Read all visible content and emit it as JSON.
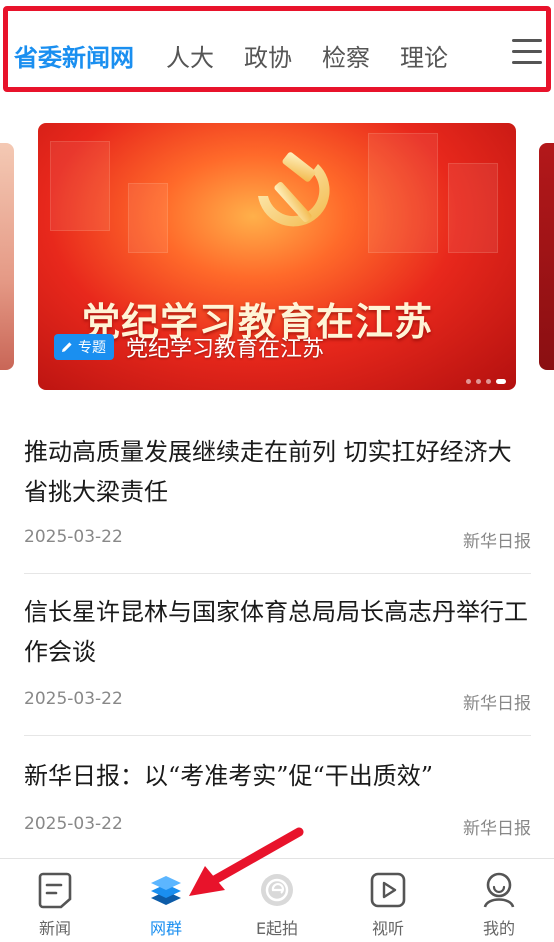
{
  "top_nav": {
    "tabs": [
      {
        "label": "省委新闻网",
        "active": true
      },
      {
        "label": "人大",
        "active": false
      },
      {
        "label": "政协",
        "active": false
      },
      {
        "label": "检察",
        "active": false
      },
      {
        "label": "理论",
        "active": false
      }
    ],
    "menu_icon": "hamburger-menu-icon"
  },
  "banner": {
    "image_text": "党纪学习教育在江苏",
    "badge": "专题",
    "badge_icon": "pencil-icon",
    "caption": "党纪学习教育在江苏",
    "slide_count": 4,
    "active_slide": 4
  },
  "news": [
    {
      "title": "推动高质量发展继续走在前列  切实扛好经济大省挑大梁责任",
      "date": "2025-03-22",
      "source": "新华日报"
    },
    {
      "title": "信长星许昆林与国家体育总局局长高志丹举行工作会谈",
      "date": "2025-03-22",
      "source": "新华日报"
    },
    {
      "title": "新华日报：以“考准考实”促“干出质效”",
      "date": "2025-03-22",
      "source": "新华日报"
    }
  ],
  "bottom_tabs": [
    {
      "label": "新闻",
      "icon": "news-doc-icon",
      "active": false
    },
    {
      "label": "网群",
      "icon": "layers-icon",
      "active": true
    },
    {
      "label": "E起拍",
      "icon": "e-camera-icon",
      "active": false
    },
    {
      "label": "视听",
      "icon": "play-icon",
      "active": false
    },
    {
      "label": "我的",
      "icon": "profile-icon",
      "active": false
    }
  ],
  "colors": {
    "accent": "#1a8ff0",
    "highlight_frame": "#e8132b",
    "annotation_arrow": "#e8132b"
  }
}
